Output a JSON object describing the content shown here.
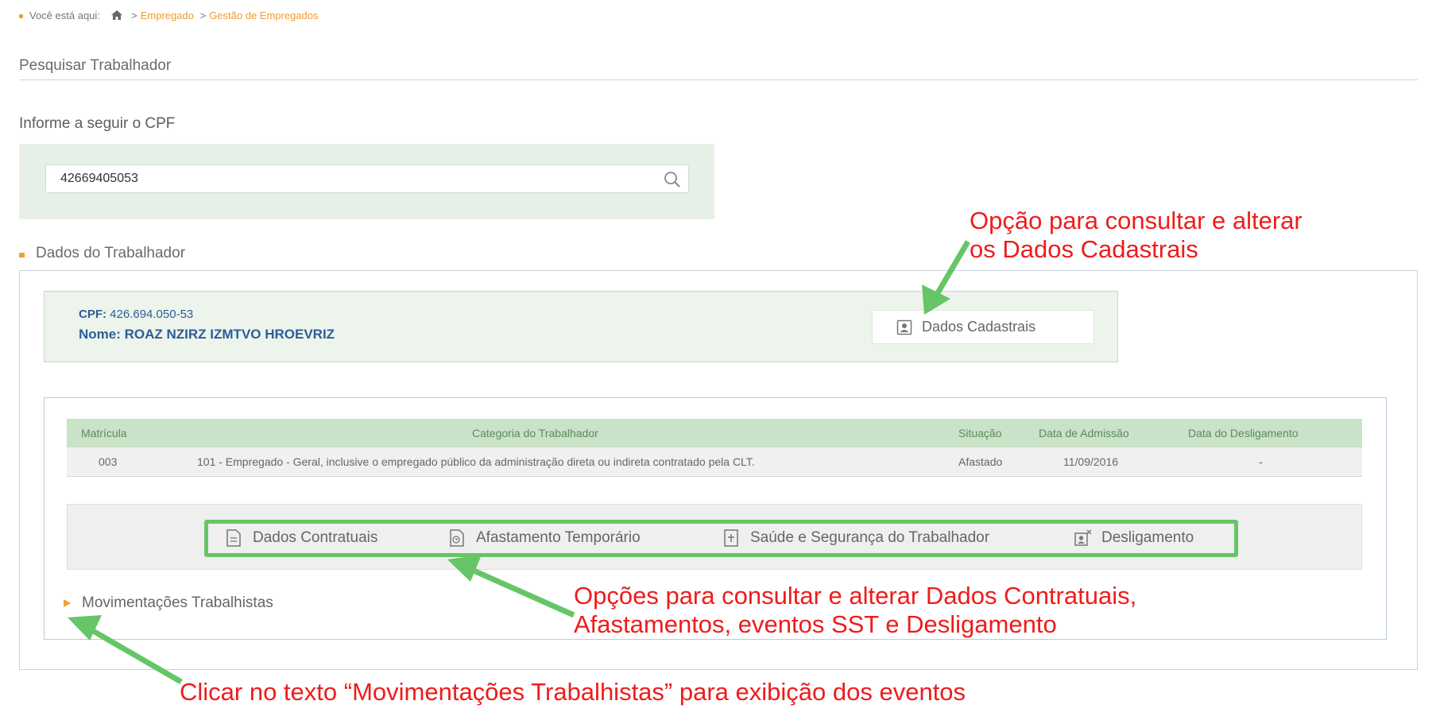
{
  "breadcrumb": {
    "prefix": "Você está aqui:",
    "items": [
      "Empregado",
      "Gestão de Empregados"
    ]
  },
  "search": {
    "section_title": "Pesquisar Trabalhador",
    "label": "Informe a seguir o CPF",
    "value": "42669405053",
    "icon": "search-icon"
  },
  "worker": {
    "section_title": "Dados do Trabalhador",
    "cpf_label": "CPF:",
    "cpf_value": "426.694.050-53",
    "nome_label": "Nome:",
    "nome_value": "ROAZ NZIRZ IZMTVO HROEVRIZ",
    "cadastrais_button": "Dados Cadastrais"
  },
  "table": {
    "headers": [
      "Matrícula",
      "Categoria do Trabalhador",
      "Situação",
      "Data de Admissão",
      "Data do Desligamento"
    ],
    "rows": [
      [
        "003",
        "101 - Empregado - Geral, inclusive o empregado público da administração direta ou indireta contratado pela CLT.",
        "Afastado",
        "11/09/2016",
        "-"
      ]
    ]
  },
  "options": [
    {
      "label": "Dados Contratuais",
      "icon": "document-icon"
    },
    {
      "label": "Afastamento Temporário",
      "icon": "leave-icon"
    },
    {
      "label": "Saúde e Segurança do Trabalhador",
      "icon": "health-icon"
    },
    {
      "label": "Desligamento",
      "icon": "dismissal-icon"
    }
  ],
  "movimentacoes": "Movimentações Trabalhistas",
  "annotations": {
    "note1": [
      "Opção para consultar e alterar",
      "os Dados Cadastrais"
    ],
    "note2": [
      "Opções para consultar e alterar Dados Contratuais,",
      "Afastamentos, eventos SST e Desligamento"
    ],
    "note3": "Clicar no texto “Movimentações Trabalhistas” para exibição dos eventos",
    "text_color": "#ee1c1c",
    "arrow_color": "#66c566"
  }
}
